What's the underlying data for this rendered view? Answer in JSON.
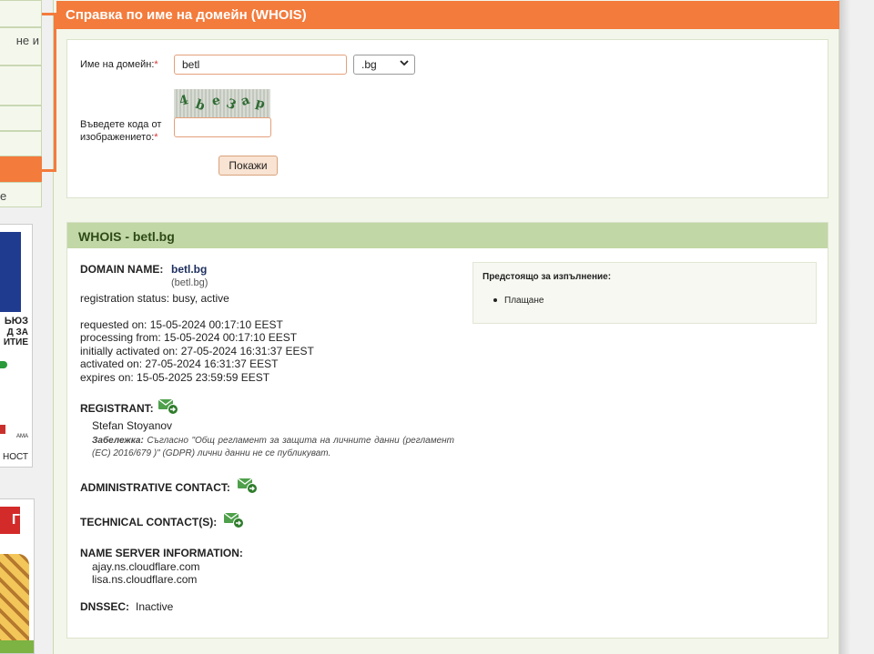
{
  "sidebar": {
    "items": [
      {
        "label": ""
      },
      {
        "label": "не и"
      },
      {
        "label": ""
      },
      {
        "label": ""
      },
      {
        "label": ""
      },
      {
        "label": ""
      },
      {
        "label": "е"
      }
    ],
    "banner_texts": [
      "ЬЮЗ",
      "Д ЗА",
      "ИТИЕ",
      "АМА",
      "НОСТ"
    ],
    "banner2_text": "Г"
  },
  "whois_form": {
    "title": "Справка по име на домейн (WHOIS)",
    "domain_label": "Име на домейн:",
    "domain_required": "*",
    "domain_value": "betl",
    "tld_selected": ".bg",
    "captcha_label_line1": "Въведете кода от",
    "captcha_label_line2": "изображението:",
    "captcha_required": "*",
    "captcha_chars": [
      "4",
      "b",
      "e",
      "3",
      "a",
      "p"
    ],
    "captcha_value": "",
    "submit_label": "Покажи"
  },
  "whois_result": {
    "heading": "WHOIS - betl.bg",
    "domain_name_label": "DOMAIN NAME:",
    "domain_name": "betl.bg",
    "domain_name_ascii": "(betl.bg)",
    "status_line": "registration status: busy, active",
    "requested_on": "requested on: 15-05-2024 00:17:10 EEST",
    "processing_from": "processing from: 15-05-2024 00:17:10 EEST",
    "initially_activated_on": "initially activated on: 27-05-2024 16:31:37 EEST",
    "activated_on": "activated on: 27-05-2024 16:31:37 EEST",
    "expires_on": "expires on: 15-05-2025 23:59:59 EEST",
    "registrant_label": "REGISTRANT:",
    "registrant_name": "Stefan Stoyanov",
    "note_label": "Забележка:",
    "note_text": "Съгласно \"Общ регламент за защита на личните данни (регламент (ЕС) 2016/679 )\" (GDPR) лични данни не се публикуват.",
    "admin_contact_label": "ADMINISTRATIVE CONTACT:",
    "tech_contact_label": "TECHNICAL CONTACT(S):",
    "ns_label": "NAME SERVER INFORMATION:",
    "ns": [
      "ajay.ns.cloudflare.com",
      "lisa.ns.cloudflare.com"
    ],
    "dnssec_label": "DNSSEC:",
    "dnssec_value": "Inactive",
    "pending_title": "Предстоящо за изпълнение:",
    "pending_items": [
      "Плащане"
    ]
  },
  "colors": {
    "accent_orange": "#f37b3c",
    "header_green": "#c1d7a5",
    "icon_green": "#3f9a3a"
  }
}
